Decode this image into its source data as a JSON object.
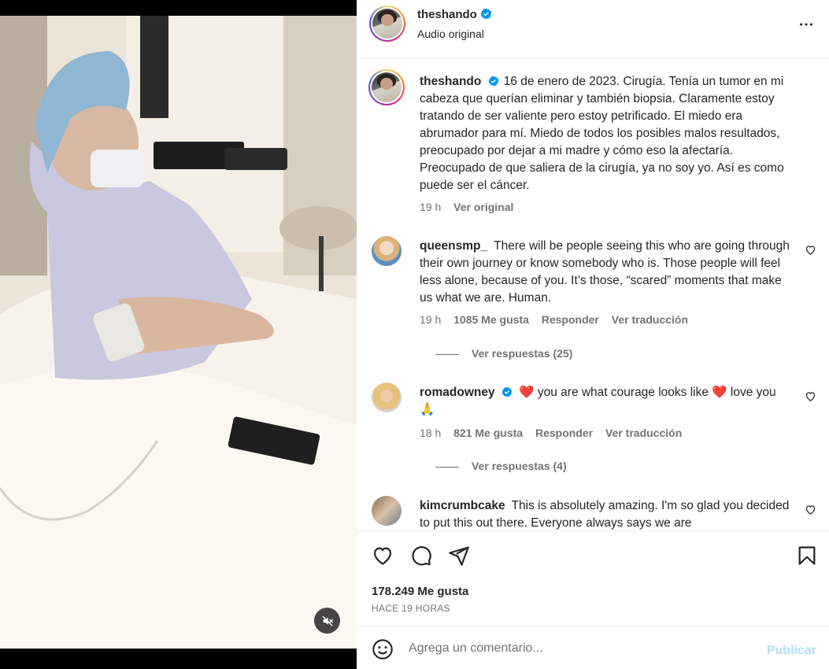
{
  "post": {
    "username": "theshando",
    "audio": "Audio original",
    "caption": "16 de enero de 2023. Cirugía. Tenía un tumor en mi cabeza que querían eliminar y también biopsia. Claramente estoy tratando de ser valiente pero estoy petrificado. El miedo era abrumador para mí. Miedo de todos los posibles malos resultados, preocupado por dejar a mi madre y cómo eso la afectaría. Preocupado de que saliera de la cirugía, ya no soy yo. Así es como puede ser el cáncer.",
    "caption_time": "19 h",
    "see_original": "Ver original",
    "likes": "178.249 Me gusta",
    "posted": "HACE 19 HORAS"
  },
  "comments": [
    {
      "username": "queensmp_",
      "text": "There will be people seeing this who are going through their own journey or know somebody who is. Those people will feel less alone, because of you. It’s those, “scared” moments that make us what we are. Human.",
      "time": "19 h",
      "likes": "1085 Me gusta",
      "reply": "Responder",
      "translate": "Ver traducción",
      "replies": "Ver respuestas (25)"
    },
    {
      "username": "romadowney",
      "text_a": "you are what courage looks like",
      "text_b": "love you",
      "heart": "❤️",
      "hands": "🙏",
      "time": "18 h",
      "likes": "821 Me gusta",
      "reply": "Responder",
      "translate": "Ver traducción",
      "replies": "Ver respuestas (4)"
    },
    {
      "username": "kimcrumbcake",
      "text": "This is absolutely amazing. I'm so glad you decided to put this out there. Everyone always says we are"
    }
  ],
  "compose": {
    "placeholder": "Agrega un comentario...",
    "publish": "Publicar"
  },
  "icons": {
    "more": "more-options-icon",
    "like": "heart-icon",
    "comment": "comment-icon",
    "share": "share-icon",
    "save": "bookmark-icon",
    "emoji": "emoji-icon",
    "mute": "muted-speaker-icon"
  },
  "colors": {
    "verified": "#0095f6",
    "publish": "#b2dffc",
    "meta": "#737373"
  }
}
